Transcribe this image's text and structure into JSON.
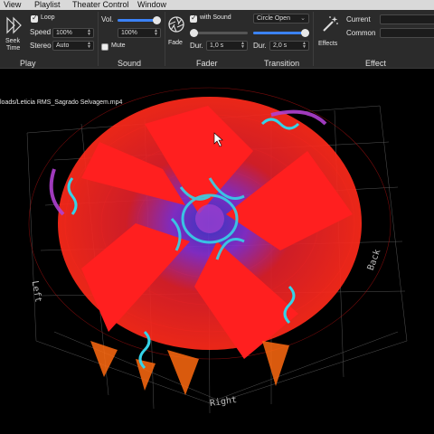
{
  "menu": [
    "View",
    "Playlist",
    "Theater Control",
    "Window"
  ],
  "play": {
    "seek_label_1": "Seek",
    "seek_label_2": "Time",
    "loop_label": "Loop",
    "speed_label": "Speed",
    "speed_value": "100%",
    "stereo_label": "Stereo",
    "stereo_value": "Auto",
    "section": "Play"
  },
  "sound": {
    "vol_label": "Vol.",
    "vol_level": 0.9,
    "vol_value": "100%",
    "mute_label": "Mute",
    "section": "Sound"
  },
  "fader": {
    "fade_label": "Fade",
    "section": "Fader"
  },
  "transition": {
    "with_sound_label": "with Sound",
    "type_value": "Circle Open",
    "dur_label": "Dur.",
    "dur1_value": "1,0 s",
    "dur2_value": "2,0 s",
    "section": "Transition"
  },
  "effect": {
    "effects_label": "Effects",
    "current_label": "Current",
    "common_label": "Common",
    "section": "Effect"
  },
  "video": {
    "filepath": "loads/Leticia RMS_Sagrado Selvagem.mp4",
    "axis_right": "Right",
    "axis_back": "Back",
    "axis_left": "Left"
  },
  "colors": {
    "accent": "#3b82f6",
    "visual_red": "#ff1f1f",
    "visual_cyan": "#35d3e8",
    "visual_purple": "#9b3fd0"
  }
}
